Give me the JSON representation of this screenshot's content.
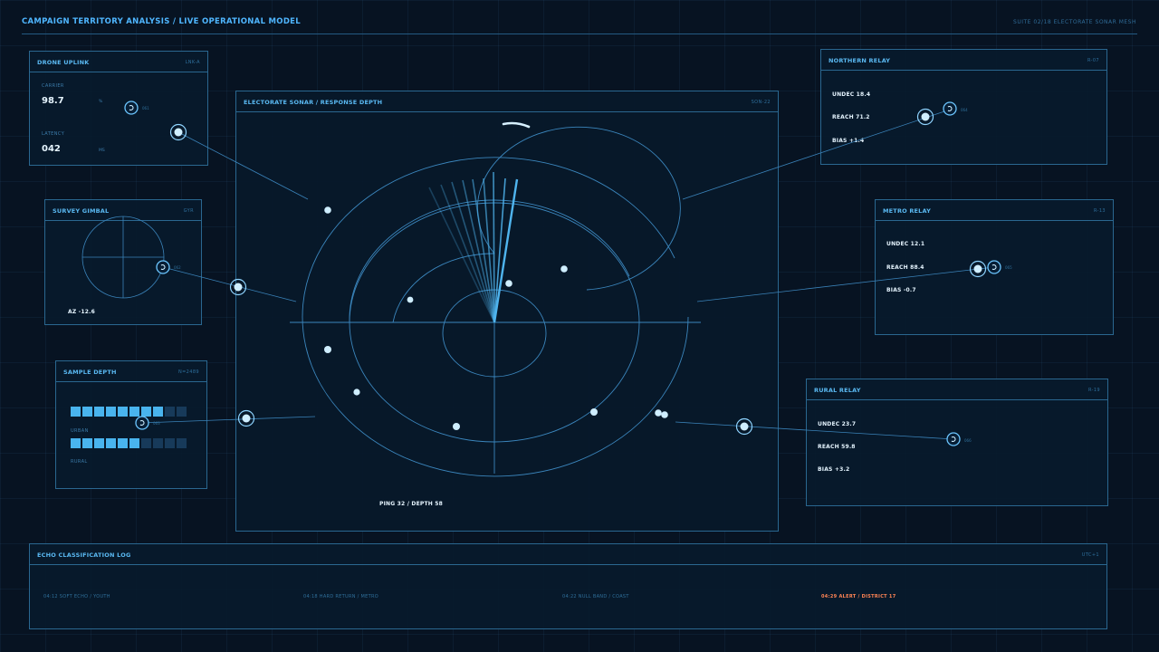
{
  "header": {
    "title": "CAMPAIGN TERRITORY ANALYSIS / LIVE OPERATIONAL MODEL",
    "suite": "SUITE 02/18 ELECTORATE SONAR MESH"
  },
  "drone_uplink": {
    "title": "DRONE UPLINK",
    "code": "LNK-A",
    "carrier_label": "CARRIER",
    "carrier_value": "98.7",
    "carrier_unit": "%",
    "latency_label": "LATENCY",
    "latency_value": "042",
    "latency_unit": "MS",
    "marker_label": "061"
  },
  "survey_gimbal": {
    "title": "SURVEY GIMBAL",
    "code": "GYR",
    "azimuth": "AZ -12.6",
    "marker_label": "062"
  },
  "sample_depth": {
    "title": "SAMPLE DEPTH",
    "code": "N=2489",
    "urban_label": "URBAN",
    "rural_label": "RURAL",
    "urban_level": 0.8,
    "rural_level": 0.6,
    "cells": 10,
    "marker_label": "063"
  },
  "sonar": {
    "title": "ELECTORATE SONAR / RESPONSE DEPTH",
    "code": "SON-22",
    "readout": "PING 32 / DEPTH 58"
  },
  "northern_relay": {
    "title": "NORTHERN RELAY",
    "code": "R-07",
    "undec": "UNDEC 18.4",
    "reach": "REACH 71.2",
    "bias": "BIAS +1.4",
    "marker_label": "064"
  },
  "metro_relay": {
    "title": "METRO RELAY",
    "code": "R-13",
    "undec": "UNDEC 12.1",
    "reach": "REACH 88.4",
    "bias": "BIAS -0.7",
    "marker_label": "065"
  },
  "rural_relay": {
    "title": "RURAL RELAY",
    "code": "R-19",
    "undec": "UNDEC 23.7",
    "reach": "REACH 59.8",
    "bias": "BIAS +3.2",
    "marker_label": "066"
  },
  "echo_log": {
    "title": "ECHO CLASSIFICATION LOG",
    "code": "UTC+1",
    "entries": [
      "04:12 SOFT ECHO / YOUTH",
      "04:18 HARD RETURN / METRO",
      "04:22 NULL BAND / COAST",
      "04:29 ALERT / DISTRICT 17"
    ]
  },
  "colors": {
    "accent": "#4fb6ff",
    "alert": "#ff8454",
    "panel_border": "#2a6790",
    "background": "#071322"
  }
}
